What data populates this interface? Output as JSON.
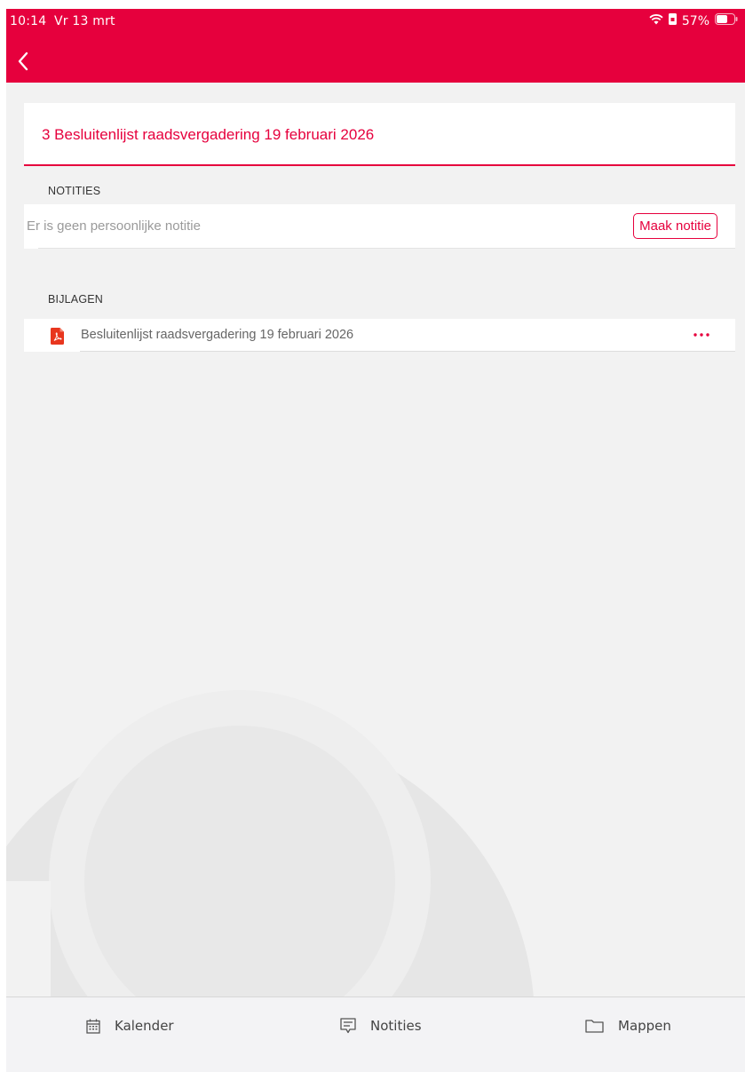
{
  "status_bar": {
    "time": "10:14",
    "date": "Vr 13 mrt",
    "battery": "57%"
  },
  "header": {
    "back_icon": "chevron-left-icon"
  },
  "meeting_item": {
    "title": "3 Besluitenlijst raadsvergadering 19 februari 2026"
  },
  "notes": {
    "section_label": "NOTITIES",
    "empty_text": "Er is geen persoonlijke notitie",
    "make_note_label": "Maak notitie"
  },
  "attachments": {
    "section_label": "BIJLAGEN",
    "items": [
      {
        "name": "Besluitenlijst raadsvergadering 19 februari 2026",
        "icon": "pdf-icon",
        "more_icon": "more-dots-icon"
      }
    ]
  },
  "tabbar": {
    "tabs": [
      {
        "label": "Kalender",
        "icon": "calendar-icon"
      },
      {
        "label": "Notities",
        "icon": "notes-icon"
      },
      {
        "label": "Mappen",
        "icon": "folder-icon"
      }
    ]
  },
  "colors": {
    "brand": "#e6003d",
    "background": "#f2f2f2",
    "card": "#ffffff"
  }
}
